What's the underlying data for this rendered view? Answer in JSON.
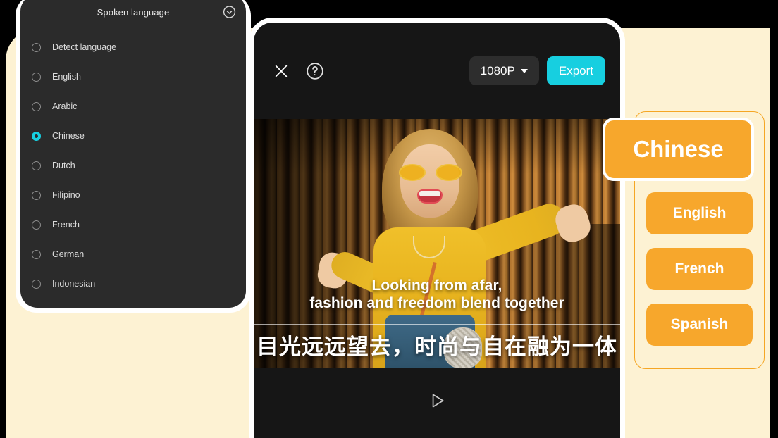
{
  "theme": {
    "page_background": "#000000",
    "cream_panel": "#fdf2d3",
    "dark_panel": "#2b2b2b",
    "video_panel": "#161616",
    "accent_cyan": "#17cfe0",
    "accent_orange": "#f7a72c",
    "orange_border": "#f5a623"
  },
  "spoken_language_panel": {
    "title": "Spoken language",
    "collapse_icon": "chevron-down-circle-icon",
    "selected": "Chinese",
    "items": [
      {
        "label": "Detect language",
        "selected": false
      },
      {
        "label": "English",
        "selected": false
      },
      {
        "label": "Arabic",
        "selected": false
      },
      {
        "label": "Chinese",
        "selected": true
      },
      {
        "label": "Dutch",
        "selected": false
      },
      {
        "label": "Filipino",
        "selected": false
      },
      {
        "label": "French",
        "selected": false
      },
      {
        "label": "German",
        "selected": false
      },
      {
        "label": "Indonesian",
        "selected": false
      }
    ]
  },
  "video_editor": {
    "toolbar": {
      "close_icon": "close-icon",
      "help_icon": "question-circle-icon",
      "resolution_label": "1080P",
      "resolution_caret_icon": "chevron-down-icon",
      "export_label": "Export"
    },
    "subtitles": {
      "source_line_1": "Looking from afar,",
      "source_line_2": "fashion and freedom blend together",
      "translated": "目光远远望去，时尚与自在融为一体"
    },
    "player": {
      "play_icon": "play-triangle-icon"
    }
  },
  "translated_languages": {
    "chips": [
      {
        "label": "Chinese",
        "active": true
      },
      {
        "label": "English",
        "active": false
      },
      {
        "label": "French",
        "active": false
      },
      {
        "label": "Spanish",
        "active": false
      }
    ]
  }
}
